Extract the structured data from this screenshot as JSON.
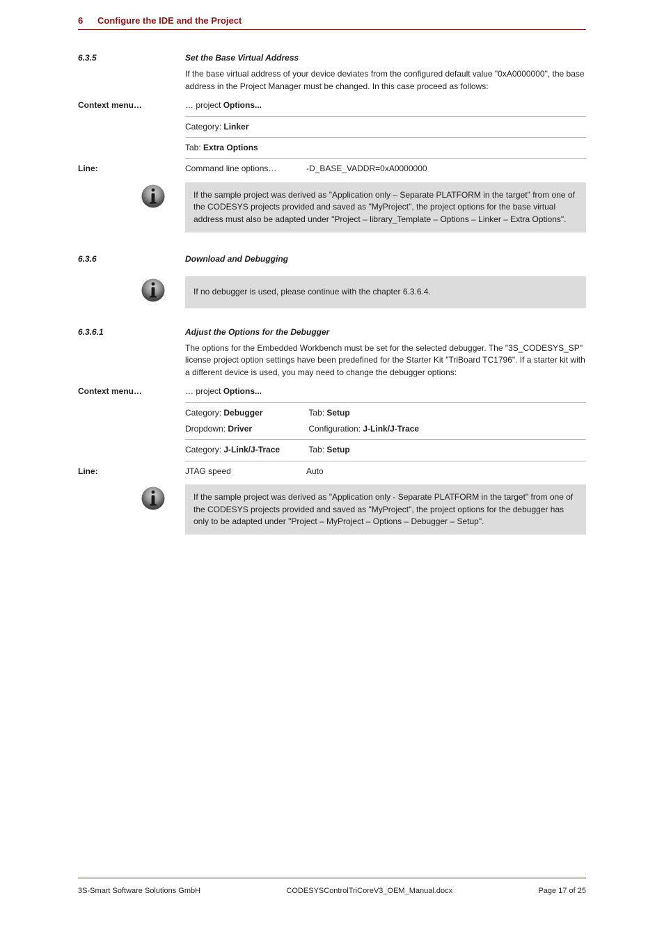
{
  "header": {
    "num": "6",
    "text": "Configure the IDE and the Project"
  },
  "section_6_3_5": {
    "num": "6.3.5",
    "title": "Set the Base Virtual Address",
    "intro": "If the base virtual address of your device deviates from the configured default value \"0xA0000000\", the base address in the Project Manager must be changed. In this case proceed as follows:",
    "rows": [
      {
        "label": "Context menu…",
        "text_a": "… project ",
        "text_b": "Options..."
      },
      {
        "label": "",
        "text_a": "Category: ",
        "text_b": "Linker"
      },
      {
        "label": "",
        "text_a": "Tab: ",
        "text_b": "Extra Options"
      },
      {
        "label": "Line: ",
        "text_a": "Command line options…",
        "text_b": "-D_BASE_VADDR=0xA0000000"
      }
    ],
    "info_lines": [
      "If the sample project was derived as \"Application only – Separate PLATFORM in the target\" from one of the CODESYS projects provided and saved as \"MyProject\", the project options for the base virtual address must also be adapted under \"Project – library_Template – Options – Linker – Extra Options\"."
    ]
  },
  "section_6_3_6": {
    "num": "6.3.6",
    "title": "Download and Debugging",
    "info1": "If no debugger is used, please continue with the chapter 6.3.6.4.",
    "section_6_3_6_1": {
      "num": "6.3.6.1",
      "title": "Adjust the Options for the Debugger",
      "intro": "The options for the Embedded Workbench must be set for the selected debugger. The \"3S_CODESYS_SP\" license project option settings have been predefined for the Starter Kit \"TriBoard TC1796\". If a starter kit with a different device is used, you may need to change the debugger options:",
      "rows": [
        {
          "label": "Context menu…",
          "text_a": "… project ",
          "text_b": "Options..."
        },
        {
          "label": "",
          "text_a": "Category: ",
          "text_b": "Debugger",
          "extra_a": "Tab: ",
          "extra_b": "Setup"
        },
        {
          "label": "",
          "text_a": "Dropdown: ",
          "text_b": "Driver",
          "extra_a": "Configuration: ",
          "extra_b": "J-Link/J-Trace"
        },
        {
          "label": "",
          "text_a": "Category: ",
          "text_b": "J-Link/J-Trace",
          "extra_a": "Tab: ",
          "extra_b": "Setup"
        },
        {
          "label": "Line:",
          "text_a": "JTAG speed",
          "text_b": "Auto"
        }
      ],
      "info_lines": [
        "If the sample project was derived as \"Application only - Separate PLATFORM in the target\" from one of the CODESYS projects provided and saved as \"MyProject\", the project options for the debugger has only to be adapted under \"Project – MyProject – Options – Debugger – Setup\"."
      ]
    }
  },
  "footer": {
    "left": "3S-Smart Software Solutions GmbH",
    "center": "CODESYSControlTriCoreV3_OEM_Manual.docx",
    "right": "Page 17 of 25"
  }
}
